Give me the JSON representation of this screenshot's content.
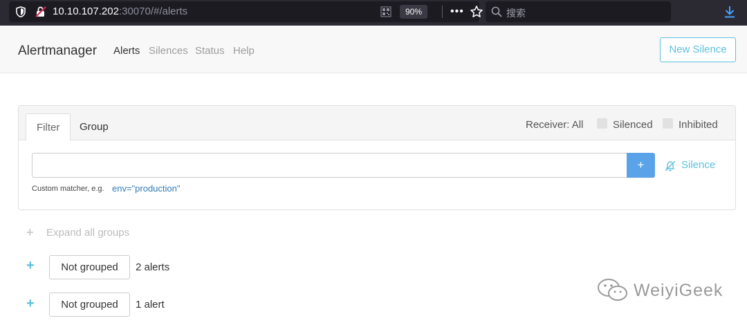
{
  "browser": {
    "url_host": "10.10.107.202",
    "url_rest": ":30070/#/alerts",
    "zoom": "90%",
    "search_placeholder": "搜索"
  },
  "navbar": {
    "brand": "Alertmanager",
    "items": [
      {
        "label": "Alerts",
        "active": true
      },
      {
        "label": "Silences",
        "active": false
      },
      {
        "label": "Status",
        "active": false
      },
      {
        "label": "Help",
        "active": false
      }
    ],
    "new_silence": "New Silence"
  },
  "filter_card": {
    "tabs": [
      "Filter",
      "Group"
    ],
    "receiver": "Receiver: All",
    "silenced_label": "Silenced",
    "inhibited_label": "Inhibited",
    "input_value": "",
    "plus_label": "+",
    "silence_link": "Silence",
    "hint": "Custom matcher, e.g.",
    "hint_example": "env=\"production\""
  },
  "groups": {
    "expand_all": "Expand all groups",
    "items": [
      {
        "label": "Not grouped",
        "count": "2 alerts"
      },
      {
        "label": "Not grouped",
        "count": "1 alert"
      }
    ]
  },
  "watermark": "WeiyiGeek",
  "colors": {
    "accent": "#5bc0de",
    "primary_button": "#5aa3e8",
    "browser_bg": "#2b2a33"
  }
}
